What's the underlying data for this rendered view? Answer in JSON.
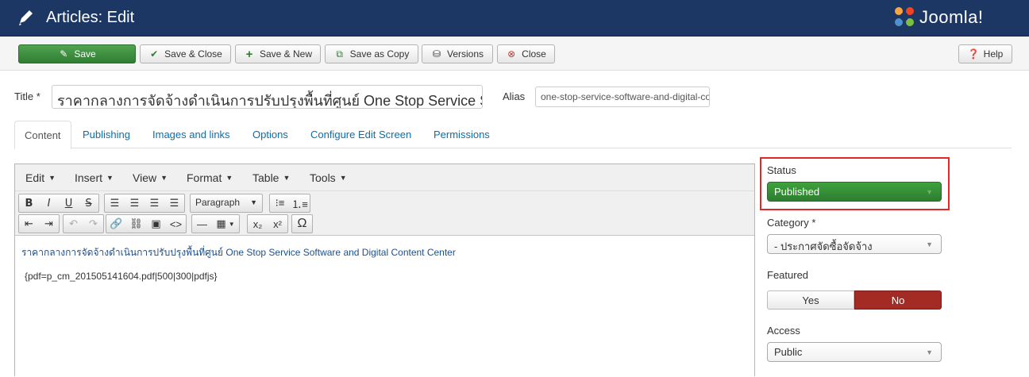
{
  "header": {
    "title": "Articles: Edit",
    "logo_text": "Joomla!"
  },
  "toolbar": {
    "save": "Save",
    "save_close": "Save & Close",
    "save_new": "Save & New",
    "save_copy": "Save as Copy",
    "versions": "Versions",
    "close": "Close",
    "help": "Help"
  },
  "form": {
    "title_label": "Title *",
    "title_value": "ราคากลางการจัดจ้างดำเนินการปรับปรุงพื้นที่ศูนย์ One Stop Service Software and Digital Content Center",
    "alias_label": "Alias",
    "alias_value": "one-stop-service-software-and-digital-content-center"
  },
  "tabs": [
    "Content",
    "Publishing",
    "Images and links",
    "Options",
    "Configure Edit Screen",
    "Permissions"
  ],
  "editor": {
    "menus": [
      "Edit",
      "Insert",
      "View",
      "Format",
      "Table",
      "Tools"
    ],
    "format_select": "Paragraph",
    "content_line1": "ราคากลางการจัดจ้างดำเนินการปรับปรุงพื้นที่ศูนย์ One Stop Service Software and Digital Content Center",
    "content_line2": "{pdf=p_cm_201505141604.pdf|500|300|pdfjs}"
  },
  "sidebar": {
    "status_label": "Status",
    "status_value": "Published",
    "category_label": "Category *",
    "category_value": "- ประกาศจัดซื้อจัดจ้าง",
    "featured_label": "Featured",
    "featured_yes": "Yes",
    "featured_no": "No",
    "access_label": "Access",
    "access_value": "Public"
  },
  "colors": {
    "header": "#1c3764",
    "save": "#3a913b",
    "no_active": "#a42b23",
    "highlight": "#e32828",
    "link": "#0a6ead"
  }
}
